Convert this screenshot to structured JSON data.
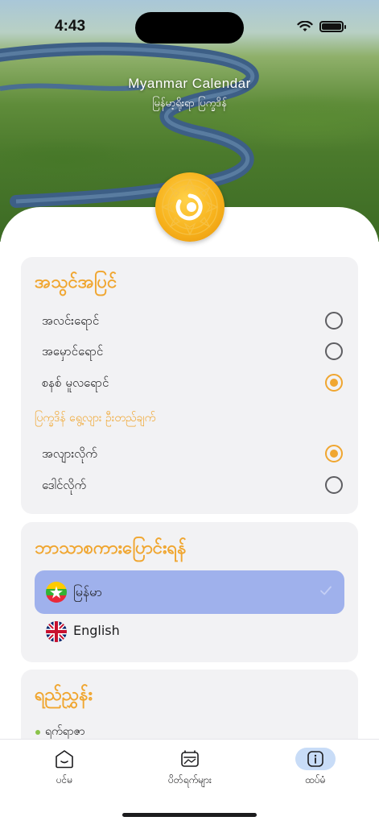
{
  "status_bar": {
    "time": "4:43"
  },
  "header": {
    "title": "Myanmar Calendar",
    "subtitle": "မြန်မာ့ရိုးရာ ပြက္ခဒိန်"
  },
  "appearance_card": {
    "title": "အသွင်အပြင်",
    "themes": [
      {
        "label": "အလင်းရောင်",
        "selected": false
      },
      {
        "label": "အမှောင်ရောင်",
        "selected": false
      },
      {
        "label": "စနစ် မူလရောင်",
        "selected": true
      }
    ],
    "sub_heading": "ပြက္ခဒိန် ရွေ့လျား ဦးတည်ချက်",
    "directions": [
      {
        "label": "အလျားလိုက်",
        "selected": true
      },
      {
        "label": "ဒေါင်လိုက်",
        "selected": false
      }
    ]
  },
  "language_card": {
    "title": "ဘာသာစကားပြောင်းရန်",
    "options": [
      {
        "label": "မြန်မာ",
        "selected": true,
        "flag": "myanmar-flag"
      },
      {
        "label": "English",
        "selected": false,
        "flag": "uk-flag"
      }
    ]
  },
  "reference_card": {
    "title": "ရည်ညွှန်း",
    "items": [
      "ရက်ရာဇာ"
    ]
  },
  "tabbar": {
    "tabs": [
      {
        "label": "ပင်မ",
        "icon": "home-icon",
        "active": false
      },
      {
        "label": "ပိတ်ရက်များ",
        "icon": "holidays-icon",
        "active": false
      },
      {
        "label": "ထပ်မံ",
        "icon": "info-icon",
        "active": true
      }
    ]
  },
  "colors": {
    "accent": "#f0a630",
    "selected_language_bg": "#9fb1ec",
    "active_tab_bg": "#c8dcf7",
    "card_bg": "#f2f2f4"
  }
}
